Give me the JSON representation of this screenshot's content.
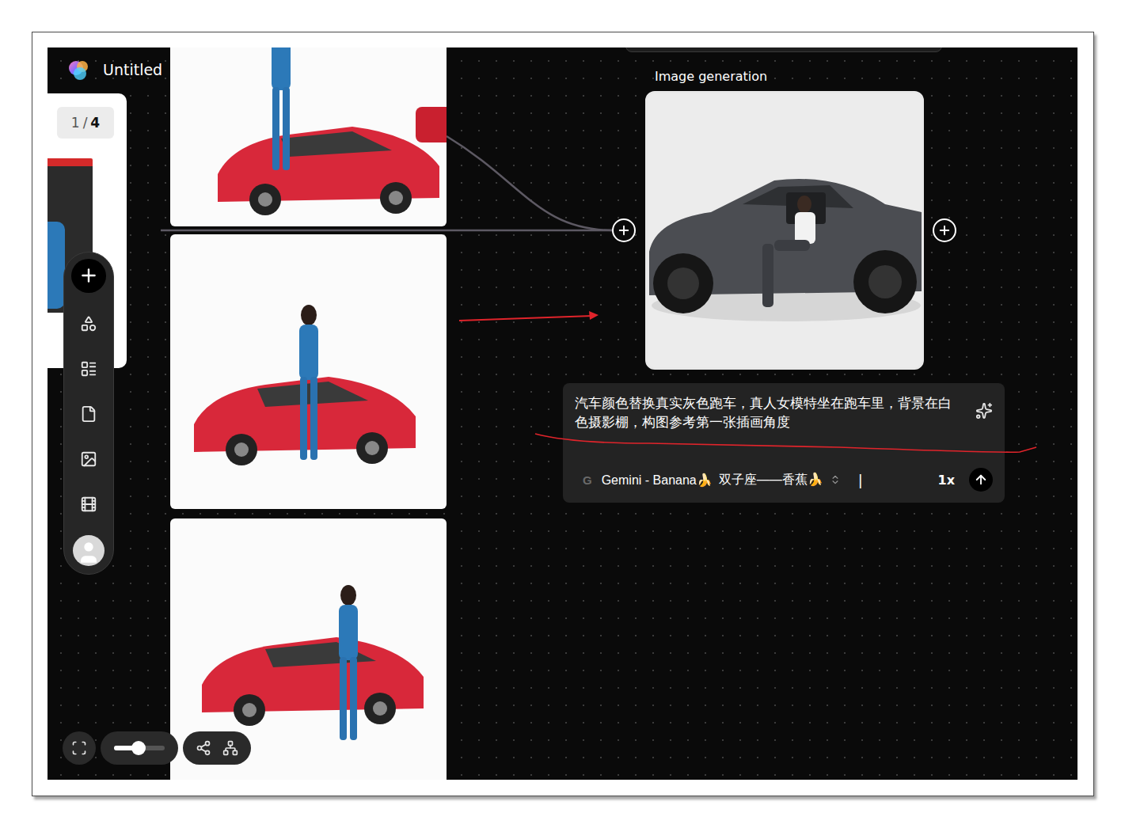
{
  "app": {
    "title": "Untitled"
  },
  "pages": {
    "current": "1",
    "separator": "/",
    "total": "4"
  },
  "node": {
    "title": "Image generation"
  },
  "prompt": {
    "text": "汽车颜色替换真实灰色跑车，真人女模特坐在跑车里，背景在白色摄影棚，构图参考第一张插画角度",
    "provider": "G",
    "model": "Gemini - Banana🍌",
    "model_label": "双子座——香蕉🍌",
    "cursor": "|",
    "count": "1x"
  },
  "zoom": {
    "level": 0.48
  }
}
